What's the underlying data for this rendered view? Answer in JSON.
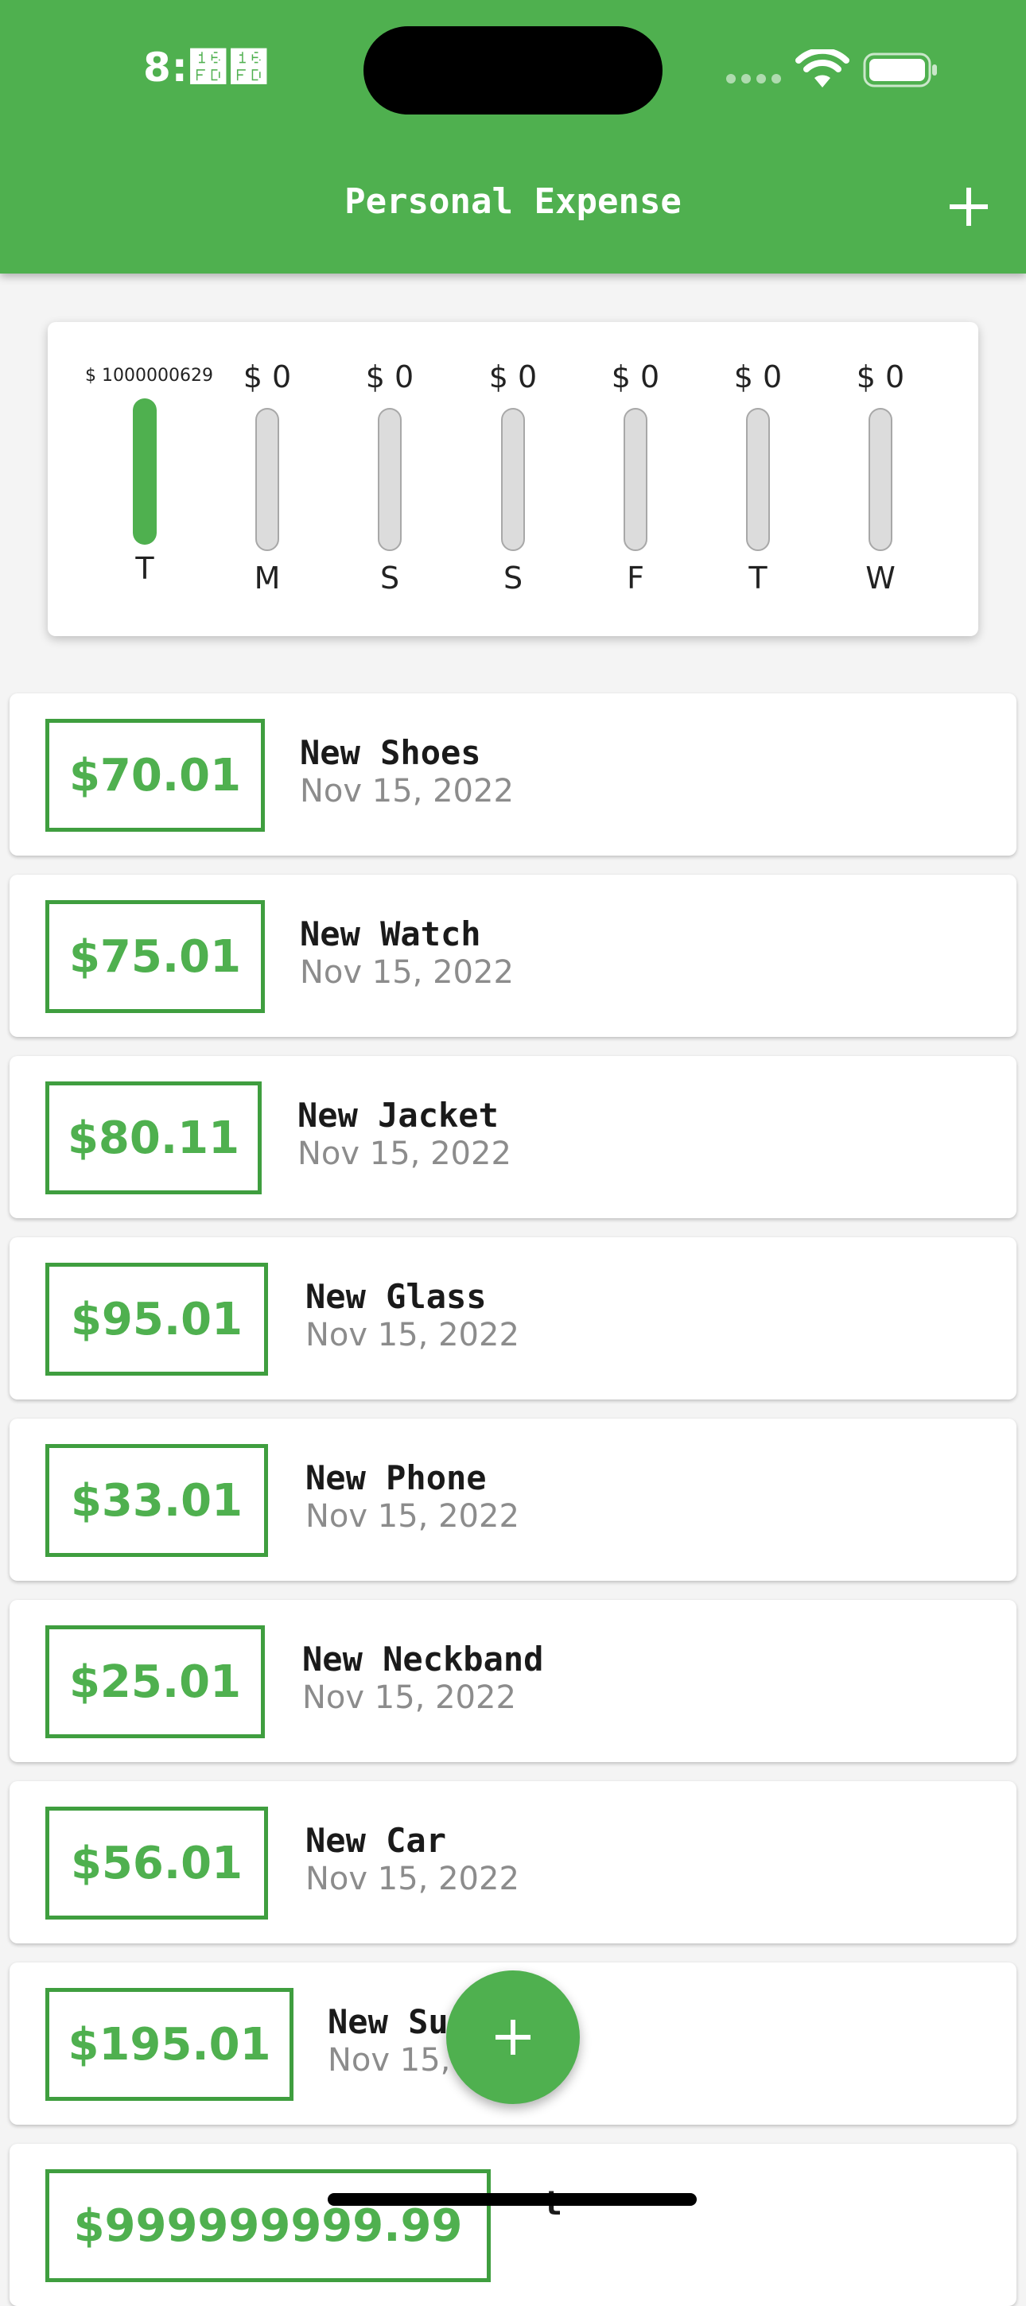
{
  "status_bar": {
    "time": "8:᛽᛽"
  },
  "app_bar": {
    "title": "Personal Expense",
    "add_icon": "plus-icon"
  },
  "chart": {
    "bars": [
      {
        "day": "T",
        "amount": "$ 1000000629",
        "fill": 1.0
      },
      {
        "day": "M",
        "amount": "$ 0",
        "fill": 0
      },
      {
        "day": "S",
        "amount": "$ 0",
        "fill": 0
      },
      {
        "day": "S",
        "amount": "$ 0",
        "fill": 0
      },
      {
        "day": "F",
        "amount": "$ 0",
        "fill": 0
      },
      {
        "day": "T",
        "amount": "$ 0",
        "fill": 0
      },
      {
        "day": "W",
        "amount": "$ 0",
        "fill": 0
      }
    ]
  },
  "transactions": [
    {
      "amount": "$70.01",
      "title": "New Shoes",
      "date": "Nov 15, 2022"
    },
    {
      "amount": "$75.01",
      "title": "New Watch",
      "date": "Nov 15, 2022"
    },
    {
      "amount": "$80.11",
      "title": "New Jacket",
      "date": "Nov 15, 2022"
    },
    {
      "amount": "$95.01",
      "title": "New Glass",
      "date": "Nov 15, 2022"
    },
    {
      "amount": "$33.01",
      "title": "New Phone",
      "date": "Nov 15, 2022"
    },
    {
      "amount": "$25.01",
      "title": "New Neckband",
      "date": "Nov 15, 2022"
    },
    {
      "amount": "$56.01",
      "title": "New Car",
      "date": "Nov 15, 2022"
    },
    {
      "amount": "$195.01",
      "title": "New Suit",
      "date": "Nov 15, 2022"
    },
    {
      "amount": "$999999999.99",
      "title": "t",
      "date": ""
    }
  ],
  "fab": {
    "icon": "plus-icon"
  },
  "colors": {
    "primary": "#4fb04f",
    "amount_border": "#3f9e3f",
    "date_text": "#8c8c8c"
  }
}
